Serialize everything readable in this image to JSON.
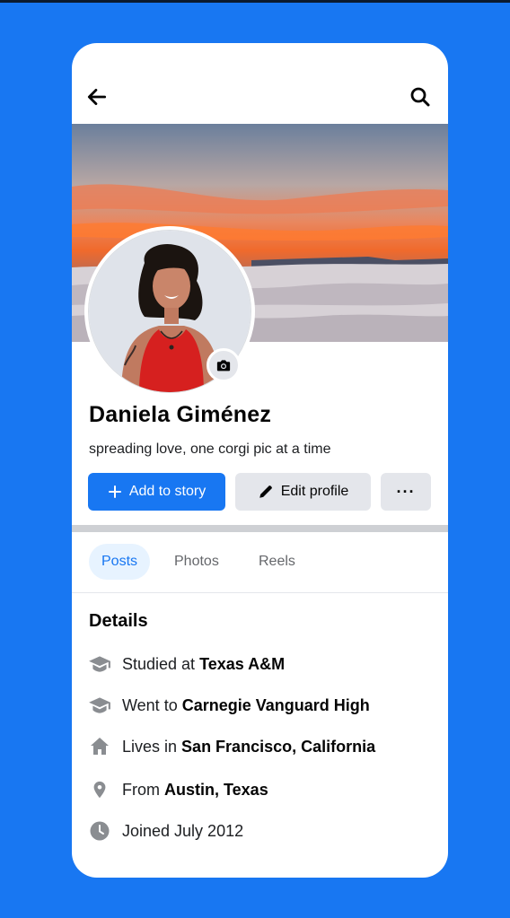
{
  "profile": {
    "name": "Daniela Giménez",
    "bio": "spreading love, one corgi pic at a time"
  },
  "actions": {
    "add_story_label": "Add to story",
    "edit_profile_label": "Edit profile",
    "more_label": "···"
  },
  "tabs": [
    {
      "label": "Posts",
      "active": true
    },
    {
      "label": "Photos",
      "active": false
    },
    {
      "label": "Reels",
      "active": false
    }
  ],
  "details": {
    "title": "Details",
    "items": [
      {
        "icon": "graduation-cap-icon",
        "prefix": "Studied at ",
        "value": "Texas A&M"
      },
      {
        "icon": "graduation-cap-icon",
        "prefix": "Went to ",
        "value": "Carnegie Vanguard High"
      },
      {
        "icon": "home-icon",
        "prefix": "Lives in ",
        "value": "San Francisco, California"
      },
      {
        "icon": "location-pin-icon",
        "prefix": "From ",
        "value": "Austin, Texas"
      },
      {
        "icon": "clock-icon",
        "prefix": "Joined July 2012",
        "value": ""
      }
    ]
  },
  "colors": {
    "background": "#1877f2",
    "accent": "#1877f2",
    "button_gray": "#e4e6eb",
    "icon_gray": "#8a8d91"
  }
}
